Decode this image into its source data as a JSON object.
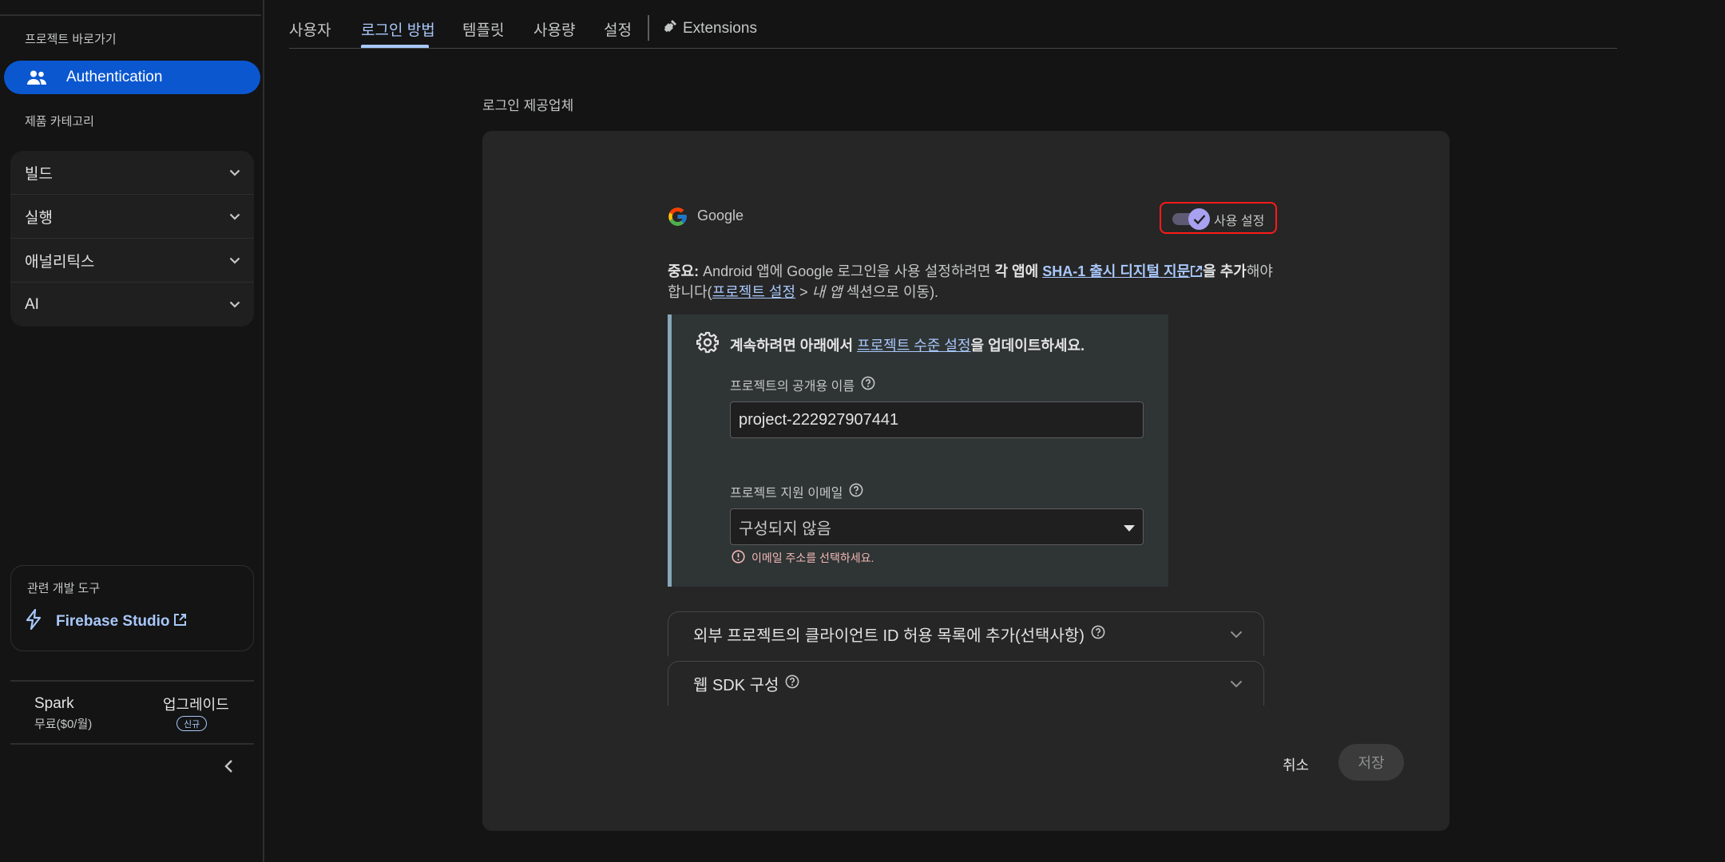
{
  "sidebar": {
    "shortcuts_caption": "프로젝트 바로가기",
    "active_item": "Authentication",
    "categories_caption": "제품 카테고리",
    "categories": [
      "빌드",
      "실행",
      "애널리틱스",
      "AI"
    ],
    "devtools_caption": "관련 개발 도구",
    "devtools_item": "Firebase Studio",
    "plan_name": "Spark",
    "plan_price": "무료($0/월)",
    "upgrade_label": "업그레이드",
    "new_badge": "신규"
  },
  "tabs": {
    "users": "사용자",
    "sign_in_method": "로그인 방법",
    "templates": "템플릿",
    "usage": "사용량",
    "settings": "설정",
    "extensions": "Extensions"
  },
  "main": {
    "section_title": "로그인 제공업체",
    "provider_name": "Google",
    "toggle_label": "사용 설정",
    "toggle_on": true,
    "note": {
      "prefix_bold": "중요:",
      "text1": " Android 앱에 Google 로그인을 사용 설정하려면 ",
      "bold1": "각 앱에",
      "link_sha": "SHA-1 출시 디지털 지문",
      "bold2": "을 추가",
      "text2": "해야",
      "line2_start": "합니다(",
      "link_project_settings": "프로젝트 설정",
      "gt": " > ",
      "italic": "내 앱",
      "line2_end": " 섹션으로 이동)."
    },
    "warning": {
      "text_before": "계속하려면 아래에서 ",
      "link": "프로젝트 수준 설정",
      "text_after": "을 업데이트하세요."
    },
    "public_name_label": "프로젝트의 공개용 이름",
    "public_name_value": "project-222927907441",
    "support_email_label": "프로젝트 지원 이메일",
    "support_email_value": "구성되지 않음",
    "support_email_error": "이메일 주소를 선택하세요.",
    "expanders": {
      "allowlist": "외부 프로젝트의 클라이언트 ID 허용 목록에 추가(선택사항)",
      "websdk": "웹 SDK 구성"
    },
    "cancel_label": "취소",
    "save_label": "저장"
  },
  "colors": {
    "accent": "#a8c7fa",
    "active_nav": "#0b57d0",
    "highlight_box": "#ff1a1a",
    "error": "#f2b8b5"
  }
}
